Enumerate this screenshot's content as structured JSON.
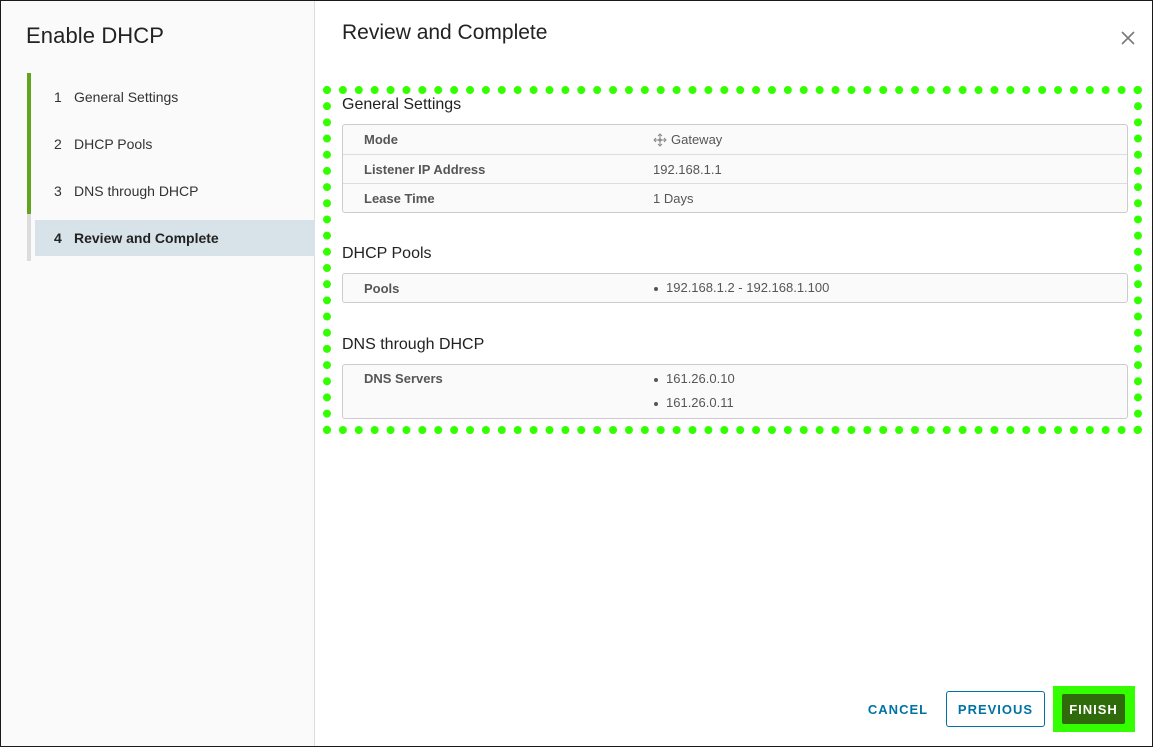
{
  "wizard": {
    "title": "Enable DHCP",
    "steps": [
      {
        "num": "1",
        "label": "General Settings"
      },
      {
        "num": "2",
        "label": "DHCP Pools"
      },
      {
        "num": "3",
        "label": "DNS through DHCP"
      },
      {
        "num": "4",
        "label": "Review and Complete"
      }
    ],
    "active_step": 4
  },
  "page": {
    "title": "Review and Complete"
  },
  "sections": {
    "general": {
      "title": "General Settings",
      "rows": [
        {
          "key": "Mode",
          "value": "Gateway",
          "icon": "gateway-icon"
        },
        {
          "key": "Listener IP Address",
          "value": "192.168.1.1"
        },
        {
          "key": "Lease Time",
          "value": "1 Days"
        }
      ]
    },
    "pools": {
      "title": "DHCP Pools",
      "key": "Pools",
      "values": [
        "192.168.1.2 - 192.168.1.100"
      ]
    },
    "dns": {
      "title": "DNS through DHCP",
      "key": "DNS Servers",
      "values": [
        "161.26.0.10",
        "161.26.0.11"
      ]
    }
  },
  "footer": {
    "cancel_label": "CANCEL",
    "previous_label": "PREVIOUS",
    "finish_label": "FINISH"
  },
  "colors": {
    "step_complete": "#62a420",
    "active_step_bg": "#d8e3e9",
    "link": "#0072a3",
    "finish_bg": "#2f6b0a",
    "highlight": "#33ff00"
  }
}
